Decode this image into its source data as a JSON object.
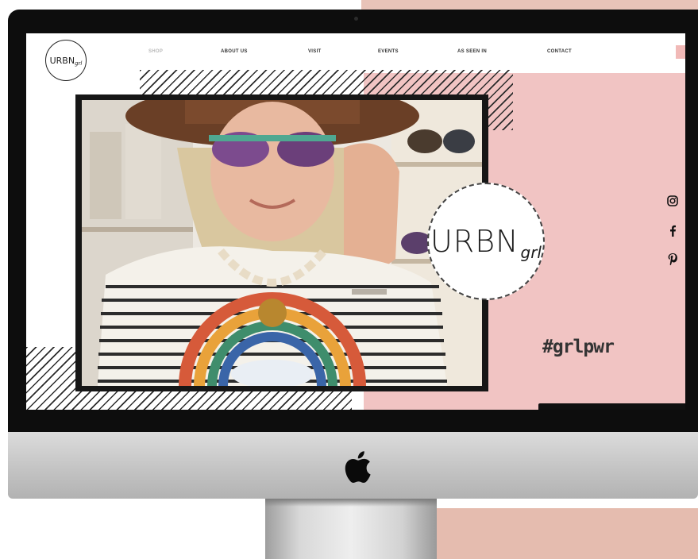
{
  "nav": {
    "logo_text": "URBN",
    "logo_script": "grl",
    "items": [
      {
        "label": "SHOP",
        "active": true
      },
      {
        "label": "ABOUT US",
        "active": false
      },
      {
        "label": "VISIT",
        "active": false
      },
      {
        "label": "EVENTS",
        "active": false
      },
      {
        "label": "AS SEEN IN",
        "active": false
      },
      {
        "label": "CONTACT",
        "active": false
      }
    ]
  },
  "hero": {
    "logo_text": "URBN",
    "logo_script": "grl",
    "hashtag": "#grlpwr",
    "photo_icon": "woman-sunglasses-photo"
  },
  "social": [
    "instagram-icon",
    "facebook-icon",
    "pinterest-icon"
  ],
  "colors": {
    "pink": "#f1c4c3",
    "accent": "#f1b9b7",
    "frame": "#161616"
  }
}
